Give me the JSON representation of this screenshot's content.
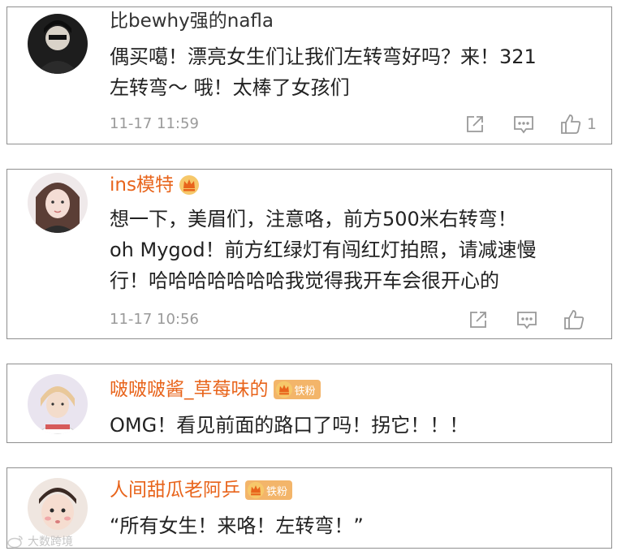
{
  "comments": [
    {
      "username": "比bewhy强的nafla",
      "text_lines": [
        "偶买噶！漂亮女生们让我们左转弯好吗？来！321",
        "左转弯～ 哦！太棒了女孩们"
      ],
      "time": "11-17 11:59",
      "like_count": "1"
    },
    {
      "username": "ins模特",
      "text_lines": [
        "想一下，美眉们，注意咯，前方500米右转弯！",
        "oh Mygod！前方红绿灯有闯红灯拍照，请减速慢",
        "行！哈哈哈哈哈哈哈我觉得我开车会很开心的"
      ],
      "time": "11-17 10:56",
      "like_count": ""
    },
    {
      "username": "啵啵啵酱_草莓味的",
      "badge": "铁粉",
      "text_lines": [
        "OMG！看见前面的路口了吗！拐它！！！"
      ]
    },
    {
      "username": "人间甜瓜老阿乒",
      "badge": "铁粉",
      "text_lines": [
        "“所有女生！来咯！左转弯！”"
      ]
    }
  ],
  "watermark": "大数跨境",
  "colors": {
    "username_orange": "#e8641b",
    "username_plain": "#333333",
    "meta_gray": "#9a9a9a",
    "badge_bg": "#f3b56a",
    "border": "#8f8f8f"
  },
  "icons": [
    "share-icon",
    "comment-icon",
    "like-icon",
    "crown-icon"
  ]
}
